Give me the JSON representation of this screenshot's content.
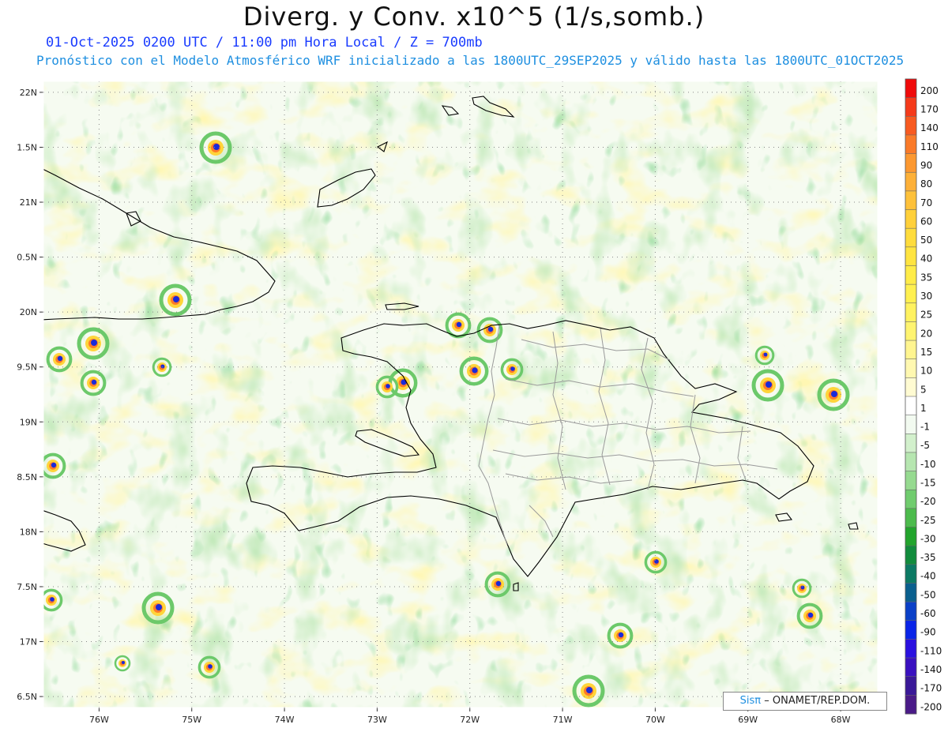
{
  "header": {
    "title": "Diverg. y Conv. x10^5 (1/s,somb.)",
    "subtitle_line1": "01-Oct-2025  0200 UTC / 11:00 pm Hora Local / Z = 700mb",
    "subtitle_line2": "Pronóstico con el Modelo Atmosférico WRF inicializado a las 1800UTC_29SEP2025 y válido hasta las  1800UTC_01OCT2025"
  },
  "map": {
    "lat_labels": [
      "22N",
      "1.5N",
      "21N",
      "0.5N",
      "20N",
      "9.5N",
      "19N",
      "8.5N",
      "18N",
      "7.5N",
      "17N",
      "6.5N"
    ],
    "lat_values": [
      22,
      21.5,
      21,
      20.5,
      20,
      19.5,
      19,
      18.5,
      18,
      17.5,
      17,
      16.5
    ],
    "lon_labels": [
      "76W",
      "75W",
      "74W",
      "73W",
      "72W",
      "71W",
      "70W",
      "69W",
      "68W"
    ],
    "lon_values": [
      -76,
      -75,
      -74,
      -73,
      -72,
      -71,
      -70,
      -69,
      -68
    ],
    "extent": {
      "lon_min": -76.6,
      "lon_max": -67.6,
      "lat_min": 16.4,
      "lat_max": 22.1
    },
    "colors": {
      "coast": "#000000",
      "provinces": "#9a9a9a",
      "grid": "#888888"
    }
  },
  "colorbar": {
    "labels": [
      "200",
      "170",
      "140",
      "110",
      "90",
      "80",
      "70",
      "60",
      "50",
      "40",
      "35",
      "30",
      "25",
      "20",
      "15",
      "10",
      "5",
      "1",
      "-1",
      "-5",
      "-10",
      "-15",
      "-20",
      "-25",
      "-30",
      "-35",
      "-40",
      "-50",
      "-60",
      "-90",
      "-110",
      "-140",
      "-170",
      "-200"
    ],
    "colors": [
      "#f00a0a",
      "#f53a1a",
      "#f85a20",
      "#fa7a28",
      "#fc9830",
      "#fdb038",
      "#fec13a",
      "#ffd03a",
      "#ffdc3c",
      "#ffe440",
      "#ffec48",
      "#fff050",
      "#fff260",
      "#fff470",
      "#fff590",
      "#fff8b0",
      "#fffbd2",
      "#ffffff",
      "#f2faf0",
      "#d2f0cc",
      "#b6e6b0",
      "#96da90",
      "#70cc6e",
      "#4cbb4c",
      "#22a42c",
      "#118c3c",
      "#0c7a64",
      "#0a5f8e",
      "#0a40c8",
      "#0a24e8",
      "#2a10e0",
      "#3a10c0",
      "#3a1898",
      "#4a1a88"
    ]
  },
  "credit": {
    "brand": "Sisπ",
    "text": "– ONAMET/REP.DOM."
  }
}
